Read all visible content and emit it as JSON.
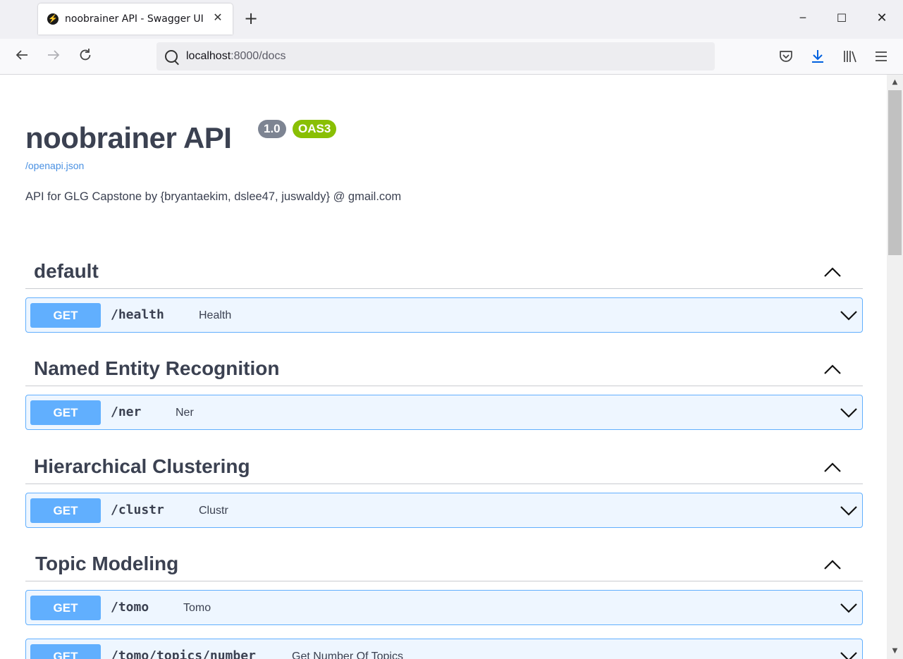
{
  "browser": {
    "tab_title": "noobrainer API - Swagger UI",
    "tab_close": "✕",
    "new_tab": "+",
    "url_host": "localhost",
    "url_rest": ":8000/docs",
    "window_minimize": "─",
    "window_maximize": "☐",
    "window_close": "✕"
  },
  "info": {
    "title": "noobrainer API",
    "version": "1.0",
    "oas": "OAS3",
    "spec_link": "/openapi.json",
    "description": "API for GLG Capstone by {bryantaekim, dslee47, juswaldy} @ gmail.com"
  },
  "sections": [
    {
      "title": "default",
      "ops": [
        {
          "method": "GET",
          "path": "/health",
          "summary": "Health"
        }
      ]
    },
    {
      "title": "Named Entity Recognition",
      "ops": [
        {
          "method": "GET",
          "path": "/ner",
          "summary": "Ner"
        }
      ]
    },
    {
      "title": "Hierarchical Clustering",
      "ops": [
        {
          "method": "GET",
          "path": "/clustr",
          "summary": "Clustr"
        }
      ]
    },
    {
      "title": "Topic Modeling",
      "ops": [
        {
          "method": "GET",
          "path": "/tomo",
          "summary": "Tomo"
        },
        {
          "method": "GET",
          "path": "/tomo/topics/number",
          "summary": "Get Number Of Topics"
        }
      ]
    }
  ]
}
